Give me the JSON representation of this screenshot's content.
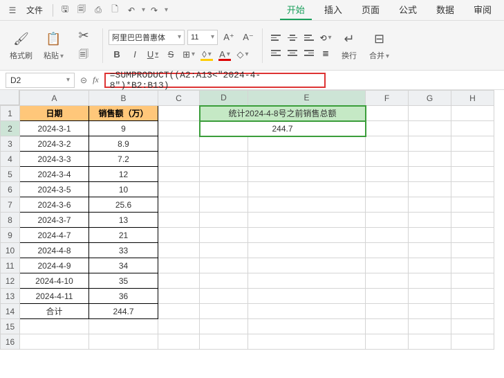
{
  "menu": {
    "file": "文件",
    "tabs": [
      "开始",
      "插入",
      "页面",
      "公式",
      "数据",
      "审阅"
    ],
    "active_tab": 0
  },
  "ribbon": {
    "format_brush": "格式刷",
    "paste": "粘贴",
    "font_name": "阿里巴巴普惠体",
    "font_size": "11",
    "wrap": "换行",
    "merge": "合并"
  },
  "formula_bar": {
    "cell_ref": "D2",
    "fx": "fx",
    "formula": "=SUMPRODUCT((A2:A13<\"2024-4-8\")*B2:B13)"
  },
  "sheet": {
    "cols": [
      "A",
      "B",
      "C",
      "D",
      "E",
      "F",
      "G",
      "H"
    ],
    "rows": [
      "1",
      "2",
      "3",
      "4",
      "5",
      "6",
      "7",
      "8",
      "9",
      "10",
      "11",
      "12",
      "13",
      "14",
      "15",
      "16"
    ],
    "header_a": "日期",
    "header_b": "销售额（万）",
    "data": [
      {
        "date": "2024-3-1",
        "val": "9"
      },
      {
        "date": "2024-3-2",
        "val": "8.9"
      },
      {
        "date": "2024-3-3",
        "val": "7.2"
      },
      {
        "date": "2024-3-4",
        "val": "12"
      },
      {
        "date": "2024-3-5",
        "val": "10"
      },
      {
        "date": "2024-3-6",
        "val": "25.6"
      },
      {
        "date": "2024-3-7",
        "val": "13"
      },
      {
        "date": "2024-4-7",
        "val": "21"
      },
      {
        "date": "2024-4-8",
        "val": "33"
      },
      {
        "date": "2024-4-9",
        "val": "34"
      },
      {
        "date": "2024-4-10",
        "val": "35"
      },
      {
        "date": "2024-4-11",
        "val": "36"
      }
    ],
    "total_label": "合计",
    "total_value": "244.7",
    "calc_title": "统计2024-4-8号之前销售总额",
    "calc_value": "244.7"
  }
}
